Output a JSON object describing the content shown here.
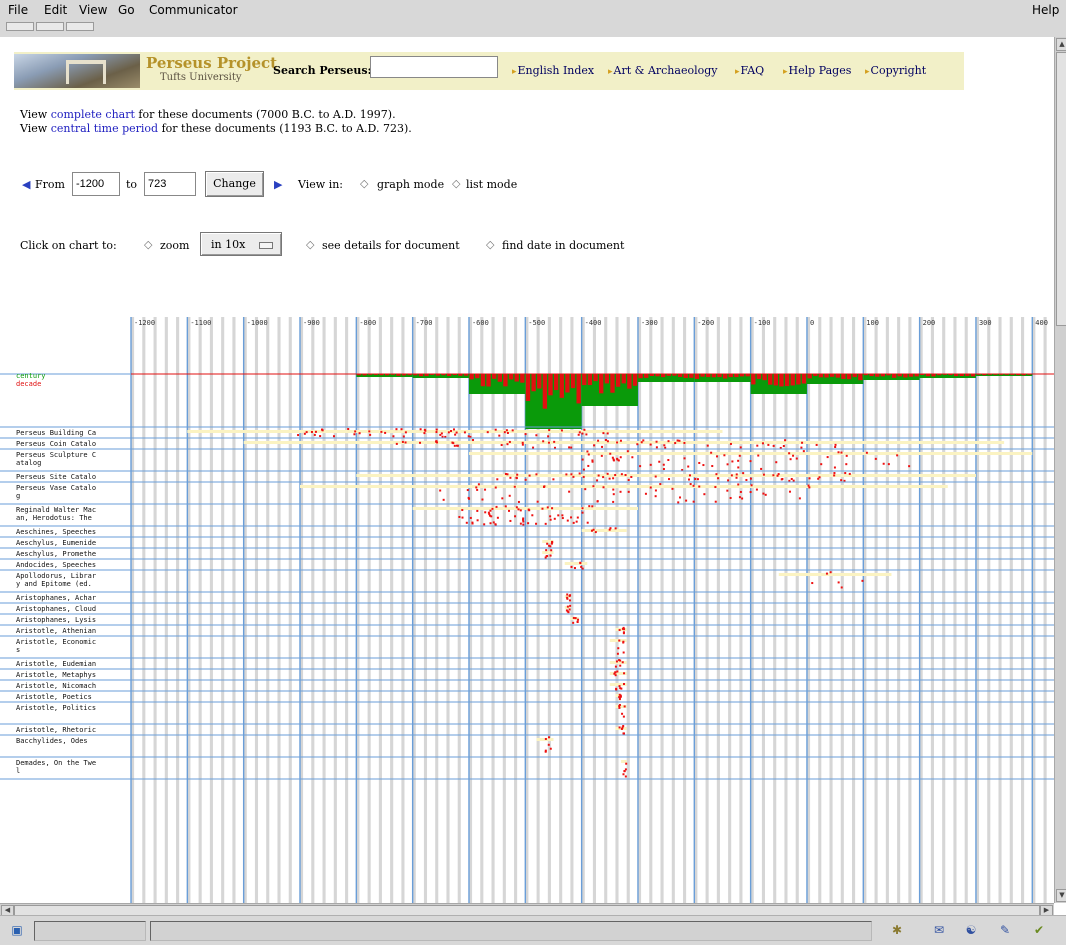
{
  "menubar": {
    "items": [
      "File",
      "Edit",
      "View",
      "Go",
      "Communicator"
    ],
    "help": "Help"
  },
  "banner": {
    "logo_title": "Perseus Project",
    "logo_subtitle": "Tufts University",
    "search_label": "Search Perseus:",
    "search_value": "",
    "links": [
      "English Index",
      "Art & Archaeology",
      "FAQ",
      "Help Pages",
      "Copyright"
    ]
  },
  "info": {
    "line1_prefix": "View",
    "line1_link": "complete chart",
    "line1_suffix": "for these documents (7000 B.C. to A.D. 1997).",
    "line2_prefix": "View",
    "line2_link": "central time period",
    "line2_suffix": "for these documents (1193 B.C. to A.D. 723)."
  },
  "range": {
    "from_label": "From",
    "from_value": "-1200",
    "to_label": "to",
    "to_value": "723",
    "change_label": "Change",
    "view_in_label": "View in:",
    "graph_mode": "graph mode",
    "list_mode": "list mode"
  },
  "click": {
    "label": "Click on chart to:",
    "zoom": "zoom",
    "zoom_select": "in 10x",
    "details": "see details for document",
    "find_date": "find date in document"
  },
  "chart_data": {
    "type": "scatter",
    "x_axis_ticks": [
      "-1200",
      "-1100",
      "-1000",
      "-900",
      "-800",
      "-700",
      "-600",
      "-500",
      "-400",
      "-300",
      "-200",
      "-100",
      "0",
      "100",
      "200",
      "300",
      "400"
    ],
    "xlim": [
      -1200,
      400
    ],
    "legend": [
      "century",
      "decade"
    ],
    "legend_colors": {
      "century": "#0a9a0a",
      "decade": "#e01010"
    },
    "rows": [
      "Perseus Building Catalog",
      "Perseus Coin Catalog",
      "Perseus Sculpture Catalog",
      "Perseus Site Catalog",
      "Perseus Vase Catalog",
      "Reginald Walter Macan, Herodotus: The Se",
      "Aeschines, Speeches",
      "Aeschylus, Eumenides (ed. Herbert Weir Sm",
      "Aeschylus, Prometheus Bound (ed. Herbert",
      "Andocides, Speeches",
      "Apollodorus, Library and Epitome (ed. Sir",
      "Aristophanes, Acharnians (ed. Jeffrey He",
      "Aristophanes, Clouds (ed. Jeffrey Henders",
      "Aristophanes, Lysistrata (ed. Jeffrey He",
      "Aristotle, Athenian Constitution (ed. H.",
      "Aristotle, Economics",
      "Aristotle, Eudemian Ethics",
      "Aristotle, Metaphysics",
      "Aristotle, Nicomachean Ethics (ed. H. Ra",
      "Aristotle, Poetics",
      "Aristotle, Politics",
      "Aristotle, Rhetoric",
      "Bacchylides, Odes",
      "Demades, On the Twel"
    ],
    "century_bars": [
      {
        "century": -800,
        "value": 3
      },
      {
        "century": -700,
        "value": 4
      },
      {
        "century": -600,
        "value": 20
      },
      {
        "century": -500,
        "value": 55
      },
      {
        "century": -400,
        "value": 32
      },
      {
        "century": -300,
        "value": 8
      },
      {
        "century": -200,
        "value": 8
      },
      {
        "century": -100,
        "value": 20
      },
      {
        "century": 0,
        "value": 10
      },
      {
        "century": 100,
        "value": 6
      },
      {
        "century": 200,
        "value": 4
      },
      {
        "century": 300,
        "value": 2
      }
    ]
  },
  "colors": {
    "banner_bg": "#f2f0c8",
    "link": "#2020c0",
    "grid_blue": "#6a9ed8",
    "century_green": "#0a9a0a",
    "decade_red": "#e01010",
    "point_red": "#ee1111",
    "range_cream": "#fbf3c2"
  },
  "statusbar_icons": [
    "component-bar-icon",
    "navigator-icon",
    "mail-icon",
    "composer-icon",
    "address-book-icon"
  ]
}
